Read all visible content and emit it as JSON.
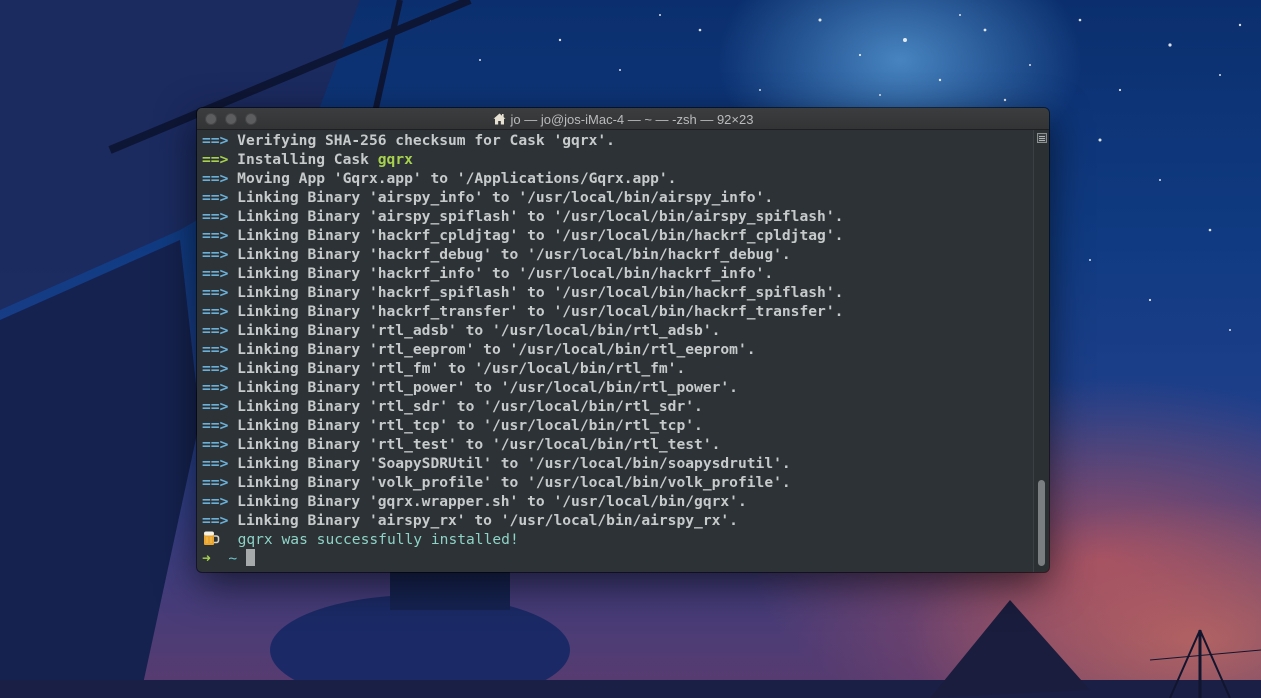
{
  "window": {
    "title": "jo — jo@jos-iMac-4 — ~ — -zsh — 92×23",
    "title_icon": "home-icon"
  },
  "terminal": {
    "lines": [
      {
        "mark": "==>",
        "text": "Verifying SHA-256 checksum for Cask 'gqrx'."
      },
      {
        "mark": "==>",
        "text": "Installing Cask ",
        "pkg": "gqrx",
        "mark_color": "green"
      },
      {
        "mark": "==>",
        "text": "Moving App 'Gqrx.app' to '/Applications/Gqrx.app'."
      },
      {
        "mark": "==>",
        "text": "Linking Binary 'airspy_info' to '/usr/local/bin/airspy_info'."
      },
      {
        "mark": "==>",
        "text": "Linking Binary 'airspy_spiflash' to '/usr/local/bin/airspy_spiflash'."
      },
      {
        "mark": "==>",
        "text": "Linking Binary 'hackrf_cpldjtag' to '/usr/local/bin/hackrf_cpldjtag'."
      },
      {
        "mark": "==>",
        "text": "Linking Binary 'hackrf_debug' to '/usr/local/bin/hackrf_debug'."
      },
      {
        "mark": "==>",
        "text": "Linking Binary 'hackrf_info' to '/usr/local/bin/hackrf_info'."
      },
      {
        "mark": "==>",
        "text": "Linking Binary 'hackrf_spiflash' to '/usr/local/bin/hackrf_spiflash'."
      },
      {
        "mark": "==>",
        "text": "Linking Binary 'hackrf_transfer' to '/usr/local/bin/hackrf_transfer'."
      },
      {
        "mark": "==>",
        "text": "Linking Binary 'rtl_adsb' to '/usr/local/bin/rtl_adsb'."
      },
      {
        "mark": "==>",
        "text": "Linking Binary 'rtl_eeprom' to '/usr/local/bin/rtl_eeprom'."
      },
      {
        "mark": "==>",
        "text": "Linking Binary 'rtl_fm' to '/usr/local/bin/rtl_fm'."
      },
      {
        "mark": "==>",
        "text": "Linking Binary 'rtl_power' to '/usr/local/bin/rtl_power'."
      },
      {
        "mark": "==>",
        "text": "Linking Binary 'rtl_sdr' to '/usr/local/bin/rtl_sdr'."
      },
      {
        "mark": "==>",
        "text": "Linking Binary 'rtl_tcp' to '/usr/local/bin/rtl_tcp'."
      },
      {
        "mark": "==>",
        "text": "Linking Binary 'rtl_test' to '/usr/local/bin/rtl_test'."
      },
      {
        "mark": "==>",
        "text": "Linking Binary 'SoapySDRUtil' to '/usr/local/bin/soapysdrutil'."
      },
      {
        "mark": "==>",
        "text": "Linking Binary 'volk_profile' to '/usr/local/bin/volk_profile'."
      },
      {
        "mark": "==>",
        "text": "Linking Binary 'gqrx.wrapper.sh' to '/usr/local/bin/gqrx'."
      },
      {
        "mark": "==>",
        "text": "Linking Binary 'airspy_rx' to '/usr/local/bin/airspy_rx'."
      }
    ],
    "success_icon": "beer-mug-icon",
    "success_text": "gqrx was successfully installed!",
    "prompt_arrow": "➜",
    "prompt_dir": "~"
  },
  "colors": {
    "terminal_bg": "#2c3235",
    "arrow_blue": "#6cb0d8",
    "accent_green": "#a7d14f",
    "success_teal": "#8fd3c7"
  }
}
